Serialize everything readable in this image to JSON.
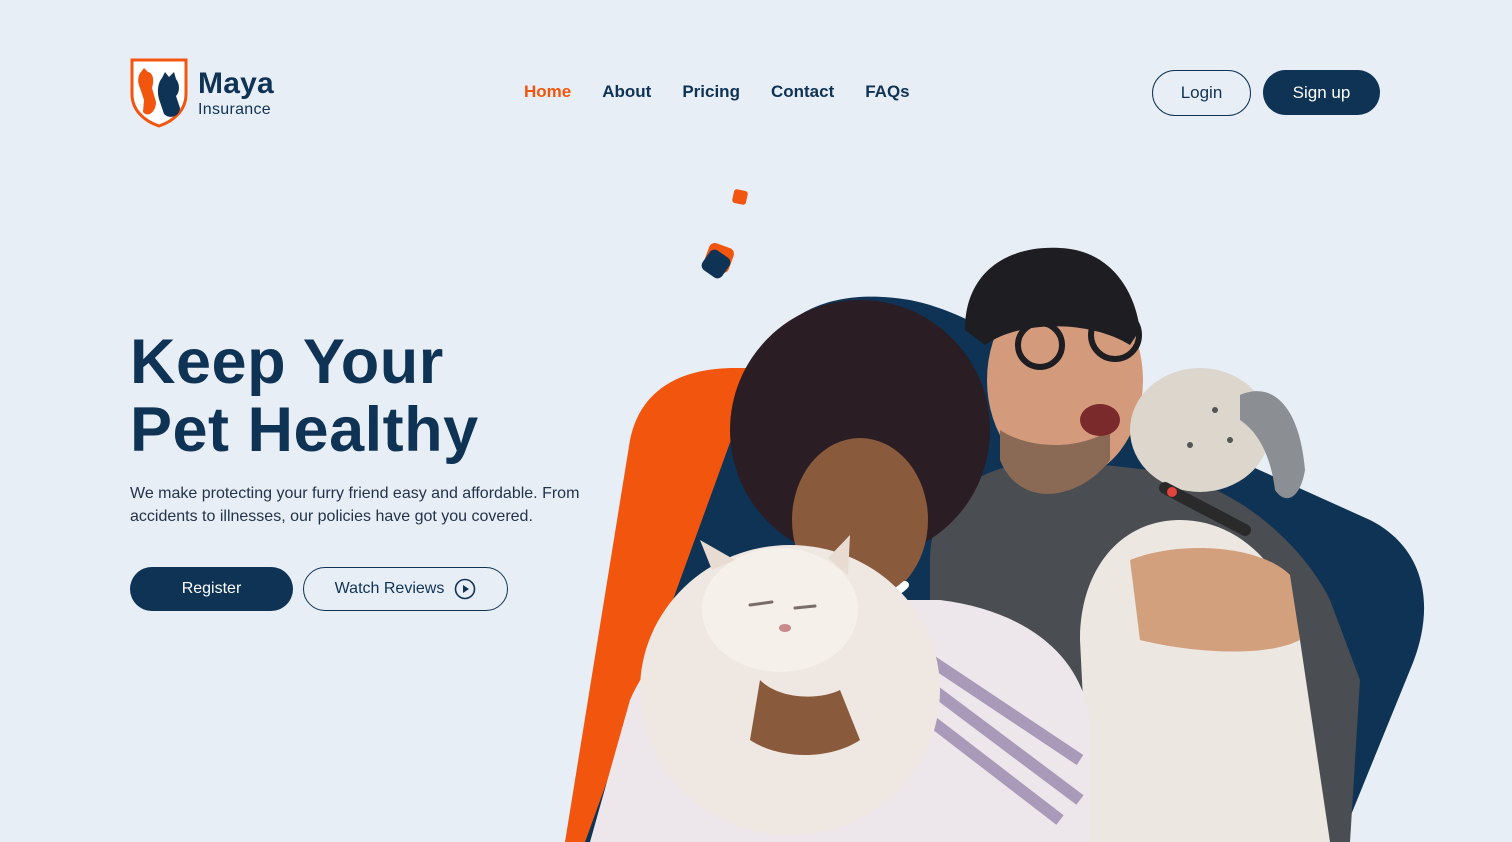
{
  "brand": {
    "name": "Maya",
    "sub": "Insurance",
    "colors": {
      "primary": "#0f3355",
      "accent": "#f2550d",
      "background": "#e8eef5"
    }
  },
  "nav": {
    "items": [
      {
        "label": "Home",
        "active": true
      },
      {
        "label": "About"
      },
      {
        "label": "Pricing"
      },
      {
        "label": "Contact"
      },
      {
        "label": "FAQs"
      }
    ]
  },
  "auth": {
    "login_label": "Login",
    "signup_label": "Sign up"
  },
  "hero": {
    "title_line1": "Keep Your",
    "title_line2": "Pet Healthy",
    "description": "We make protecting your furry friend easy and affordable. From accidents to illnesses, our policies have got you covered.",
    "register_label": "Register",
    "reviews_label": "Watch Reviews",
    "reviews_icon": "play-circle-icon"
  }
}
